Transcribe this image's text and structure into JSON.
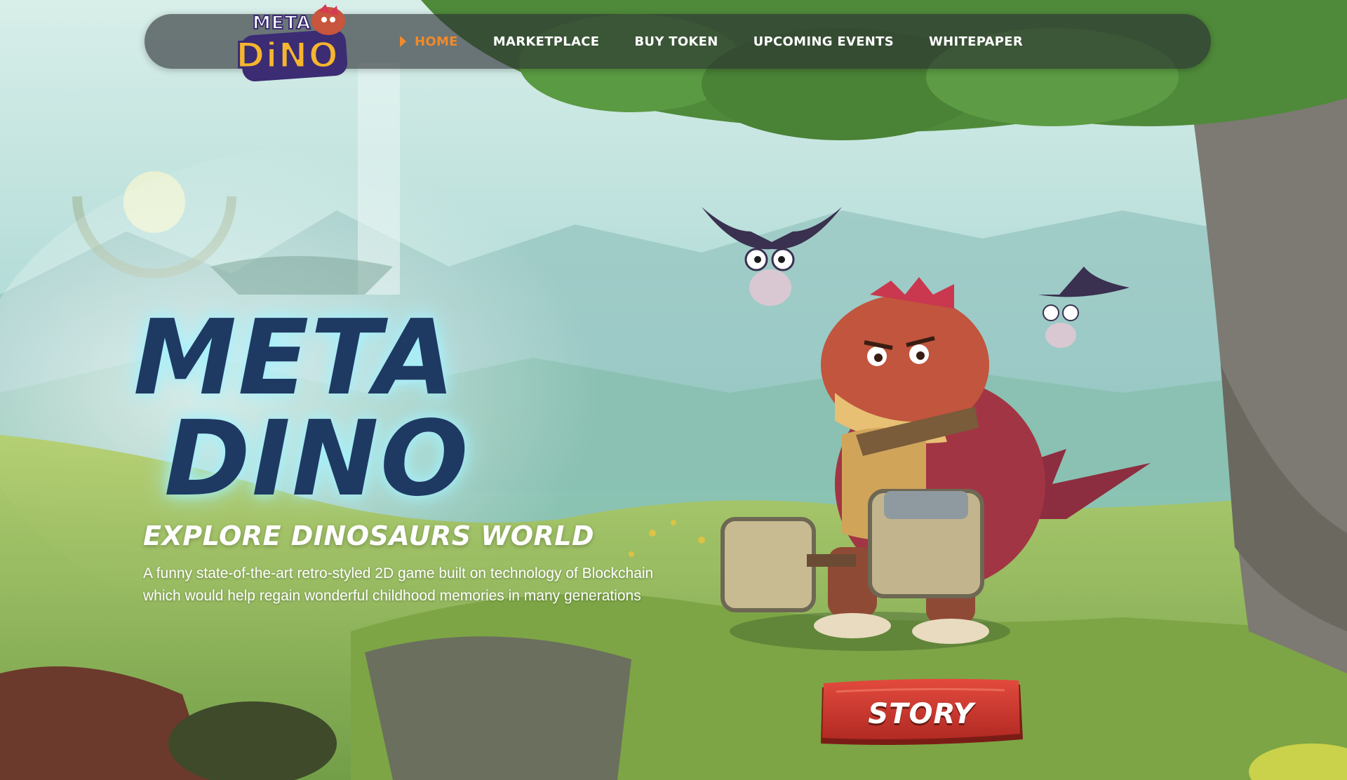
{
  "brand": {
    "logo_top": "META",
    "logo_bottom": "DiNO"
  },
  "nav": {
    "items": [
      {
        "label": "HOME",
        "active": true
      },
      {
        "label": "MARKETPLACE",
        "active": false
      },
      {
        "label": "BUY TOKEN",
        "active": false
      },
      {
        "label": "UPCOMING EVENTS",
        "active": false
      },
      {
        "label": "WHITEPAPER",
        "active": false
      }
    ]
  },
  "hero": {
    "title_line1": "META",
    "title_line2": "DINO",
    "subtitle": "EXPLORE DINOSAURS WORLD",
    "description_line1": "A funny state-of-the-art retro-styled 2D game built on technology of Blockchain",
    "description_line2": "which would help regain wonderful childhood memories in many generations"
  },
  "cta": {
    "story_label": "STORY"
  },
  "colors": {
    "accent": "#f08a2a",
    "title": "#1e3a62",
    "button": "#c9312a"
  }
}
